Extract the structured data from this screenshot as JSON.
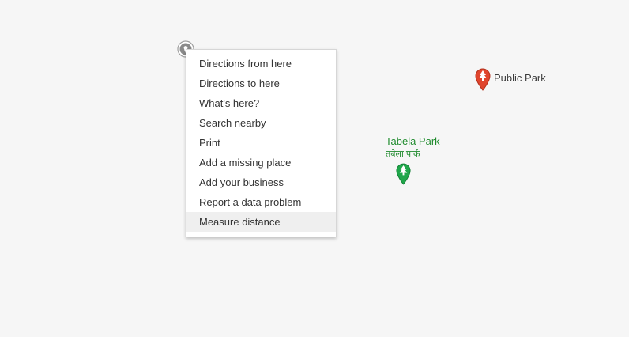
{
  "map": {
    "context_menu": {
      "items": [
        {
          "label": "Directions from here"
        },
        {
          "label": "Directions to here"
        },
        {
          "label": "What's here?"
        },
        {
          "label": "Search nearby"
        },
        {
          "label": "Print"
        },
        {
          "label": "Add a missing place"
        },
        {
          "label": "Add your business"
        },
        {
          "label": "Report a data problem"
        },
        {
          "label": "Measure distance",
          "highlighted": true
        }
      ]
    },
    "places": {
      "public_park": {
        "label": "Public Park",
        "icon": "tree-pin-icon",
        "color": "#e0452d"
      },
      "tabela_park": {
        "label": "Tabela Park",
        "sublabel": "तबेला पार्क",
        "icon": "tree-pin-icon",
        "color": "#1fa64a"
      }
    },
    "click_marker": {
      "icon": "dropped-pin-icon"
    }
  }
}
